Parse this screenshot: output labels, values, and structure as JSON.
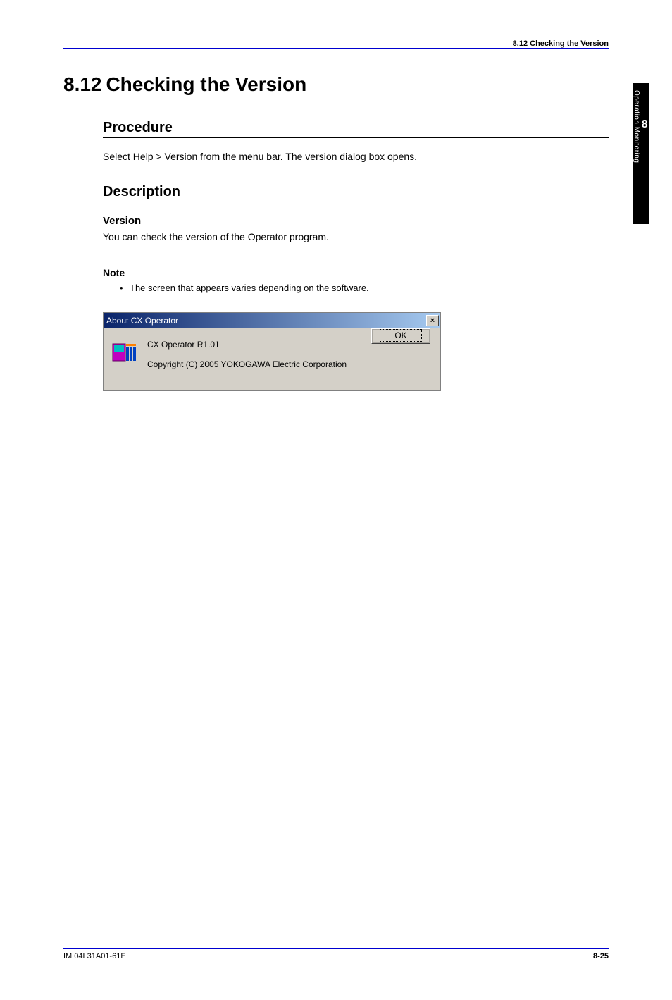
{
  "header": {
    "right": "8.12  Checking the Version"
  },
  "sidetab": {
    "num": "8",
    "text": "Operation Monitoring"
  },
  "section": {
    "num": "8.12",
    "title": "Checking the Version"
  },
  "procedure": {
    "heading": "Procedure",
    "body": "Select Help > Version from the menu bar.  The version dialog box opens."
  },
  "description": {
    "heading": "Description",
    "sub": "Version",
    "body": "You can check the version of the Operator program."
  },
  "note": {
    "label": "Note",
    "body": "The screen that appears varies depending on the software."
  },
  "dialog": {
    "title": "About CX Operator",
    "line1": "CX Operator R1.01",
    "line2": "Copyright (C) 2005 YOKOGAWA Electric Corporation",
    "ok": "OK",
    "close": "×"
  },
  "footer": {
    "left": "IM 04L31A01-61E",
    "right": "8-25"
  }
}
